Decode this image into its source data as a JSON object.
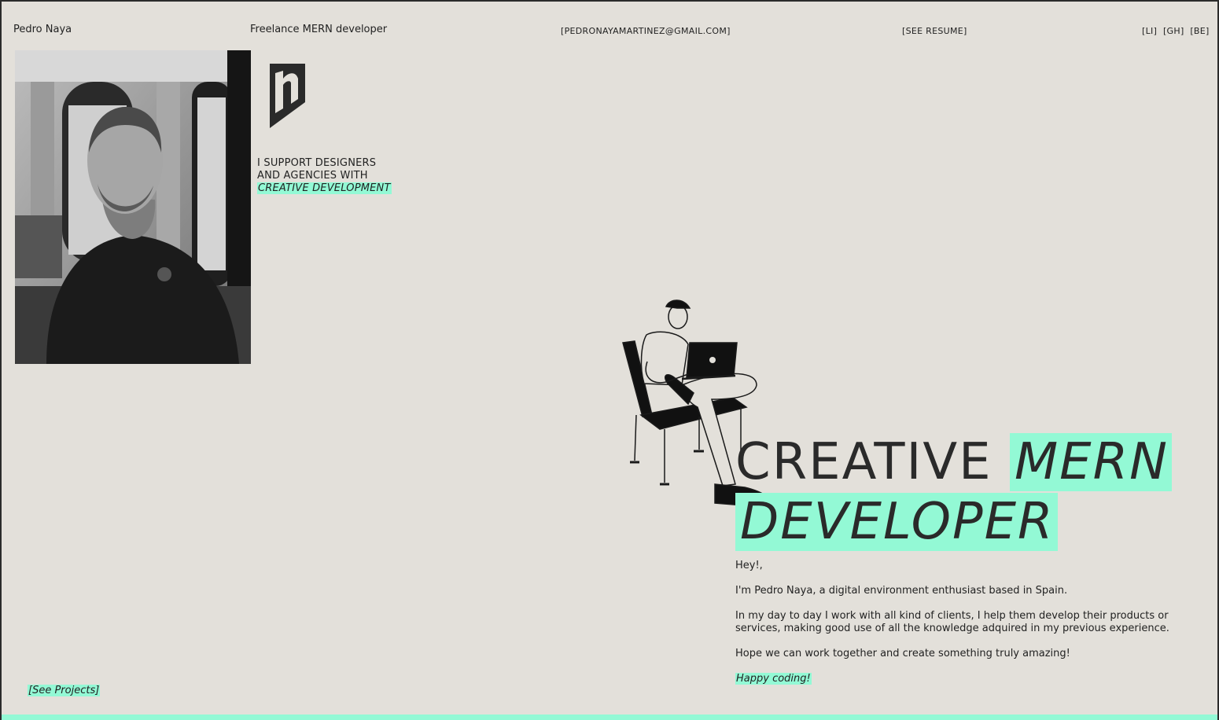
{
  "header": {
    "name": "Pedro Naya",
    "role": "Freelance MERN developer",
    "email": "[PEDRONAYAMARTINEZ@GMAIL.COM]",
    "resume": "[SEE RESUME]",
    "socials": [
      "[LI]",
      "[GH]",
      "[BE]"
    ]
  },
  "tagline": {
    "line1": "I SUPPORT DESIGNERS",
    "line2": "AND AGENCIES WITH",
    "highlight": "CREATIVE DEVELOPMENT"
  },
  "headline": {
    "word1": "CREATIVE",
    "word2": "MERN",
    "word3": "DEVELOPER"
  },
  "bio": {
    "greeting": "Hey!,",
    "intro": "I'm Pedro Naya, a digital environment enthusiast based in Spain.",
    "day_to_day": "In my day to day I work with all kind of clients, I help them develop their products or services, making good use of all the knowledge adquired in my previous experience.",
    "hope": "Hope we can work together and create something truly amazing!",
    "signoff": "Happy coding!"
  },
  "see_projects": "[See Projects]",
  "colors": {
    "background": "#e3e0da",
    "accent": "#93f9d5",
    "text": "#222222"
  },
  "icons": [
    "logo-icon",
    "developer-illustration"
  ]
}
